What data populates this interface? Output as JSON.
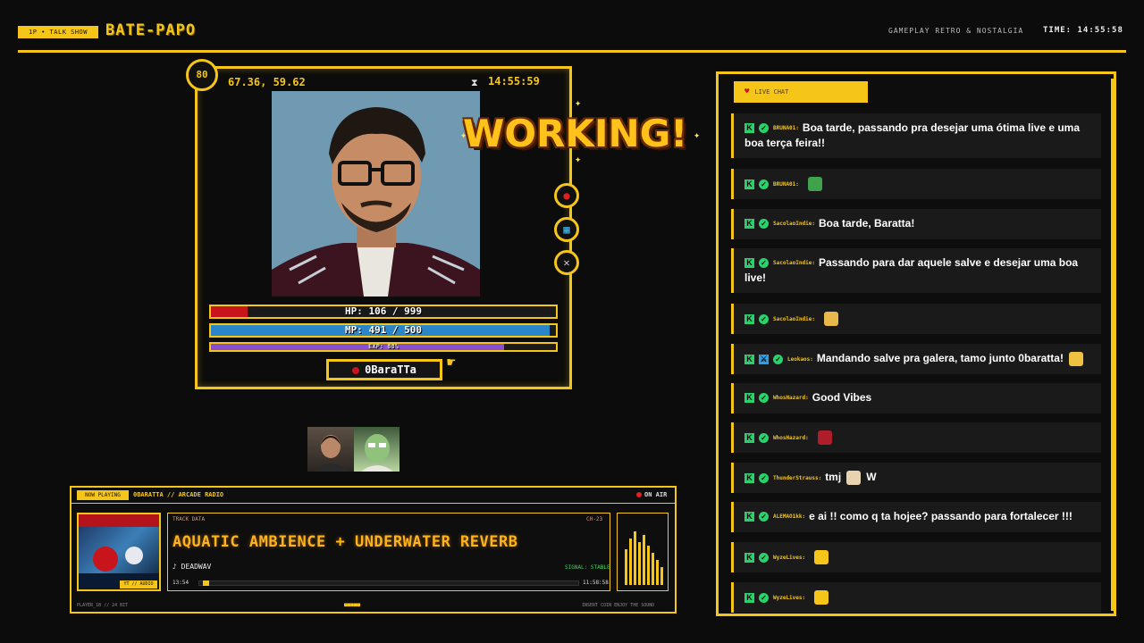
{
  "header": {
    "badge": "1P • TALK SHOW",
    "title": "BATE-PAPO",
    "subtitle": "GAMEPLAY RETRO & NOSTALGIA",
    "time_label": "TIME: 14:55:58"
  },
  "player": {
    "level": "80",
    "coords": "67.36, 59.62",
    "time": "14:55:59",
    "hp_label": "HP: 106 / 999",
    "hp_fraction": 0.106,
    "mp_label": "MP: 491 / 500",
    "mp_fraction": 0.982,
    "xp_label": "EXP: 88%",
    "xp_fraction": 0.85,
    "name": "0BaraTTa"
  },
  "overlay": {
    "working_text": "WORKING!"
  },
  "radio": {
    "now_playing": "NOW PLAYING",
    "station": "0BARATTA // ARCADE RADIO",
    "on_air": "ON AIR",
    "cover_tag": "YT // AUDIO",
    "track_label": "TRACK DATA",
    "channel": "CH-23",
    "title": "AQUATIC AMBIENCE + UNDERWATER REVERB",
    "artist": "♪ DEADWAV",
    "signal": "SIGNAL: STABLE",
    "current": "13:54",
    "duration": "11:58:58",
    "progress_fraction": 0.01,
    "footer_left": "PLAYER_1B // 24 BIT",
    "footer_mid": "■■■■■",
    "footer_right": "INSERT COIN      ENJOY THE SOUND"
  },
  "chat": {
    "tab_label": "LIVE CHAT",
    "messages": [
      {
        "user": "BRUNA01:",
        "text": "Boa tarde, passando pra desejar uma ótima live e uma",
        "text2": "boa terça feira!!"
      },
      {
        "user": "BRUNA01:",
        "text": "",
        "emote": "frog-emote"
      },
      {
        "user": "SacolaoIndie:",
        "text": "Boa tarde, Baratta!"
      },
      {
        "user": "SacolaoIndie:",
        "text": "Passando para dar aquele salve e desejar uma boa",
        "text2": "live!"
      },
      {
        "user": "SacolaoIndie:",
        "text": "",
        "emote": "hand-emote"
      },
      {
        "user": "Leokaos:",
        "text": "Mandando salve pra galera, tamo junto 0baratta!",
        "emote": "fist-emote"
      },
      {
        "user": "WhosHazard:",
        "text": "Good Vibes"
      },
      {
        "user": "WhosHazard:",
        "text": "",
        "emote": "character-emote"
      },
      {
        "user": "ThunderStrauss:",
        "text": "tmj",
        "text_after": "W",
        "emote": "cat-emote"
      },
      {
        "user": "ALEMAO1kk:",
        "text": "e ai !! como q ta hojee? passando para fortalecer !!!"
      },
      {
        "user": "WyzeLives:",
        "text": "",
        "emote": "cat-face-emote"
      },
      {
        "user": "WyzeLives:",
        "text": "",
        "emote": "cat-face-emote"
      }
    ]
  },
  "colors": {
    "accent": "#f5c518",
    "hp": "#c8141b",
    "mp": "#2b86c9",
    "xp": "#8a4fd0",
    "kick_green": "#28d36a"
  }
}
